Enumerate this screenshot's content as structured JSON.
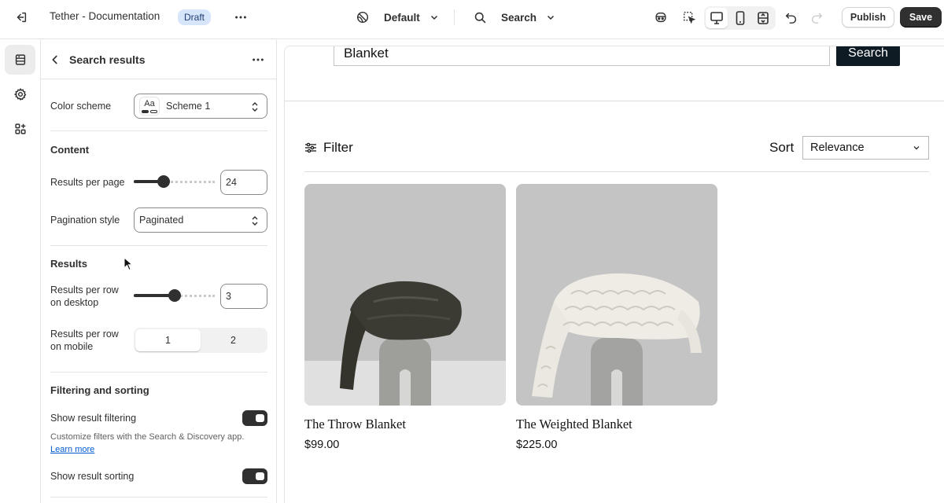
{
  "topbar": {
    "title": "Tether - Documentation",
    "badge": "Draft",
    "theme": "Default",
    "page_selector": "Search",
    "publish_label": "Publish",
    "save_label": "Save"
  },
  "panel": {
    "title": "Search results",
    "color_scheme_label": "Color scheme",
    "color_scheme_value": "Scheme 1",
    "color_scheme_swatch": "Aa",
    "content_heading": "Content",
    "results_per_page_label": "Results per page",
    "results_per_page_value": "24",
    "results_per_page_level": 0.35,
    "pagination_label": "Pagination style",
    "pagination_value": "Paginated",
    "results_heading": "Results",
    "per_row_desktop_label_1": "Results per row",
    "per_row_desktop_label_2": "on desktop",
    "per_row_desktop_value": "3",
    "per_row_desktop_level": 0.5,
    "per_row_mobile_label_1": "Results per row",
    "per_row_mobile_label_2": "on mobile",
    "mobile_options": [
      "1",
      "2"
    ],
    "mobile_selected": "1",
    "filtering_heading": "Filtering and sorting",
    "show_filtering_label": "Show result filtering",
    "filtering_help": "Customize filters with the Search & Discovery app.",
    "learn_more": "Learn more",
    "show_sorting_label": "Show result sorting"
  },
  "preview": {
    "search_value": "Blanket",
    "search_button": "Search",
    "filter_label": "Filter",
    "sort_label": "Sort",
    "sort_value": "Relevance",
    "products": [
      {
        "title": "The Throw Blanket",
        "price": "$99.00"
      },
      {
        "title": "The Weighted Blanket",
        "price": "$225.00"
      }
    ]
  },
  "colors": {
    "accent_dark": "#303030",
    "badge_bg": "#d7e5fb",
    "link": "#005bd3",
    "preview_button": "#0e1b25"
  }
}
